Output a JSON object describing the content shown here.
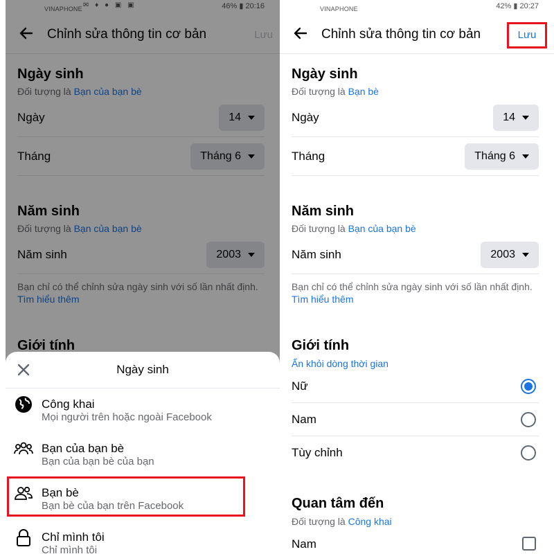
{
  "status": {
    "carrier": "VINAPHONE",
    "left_battery": "46%",
    "left_time": "20:16",
    "right_battery": "42%",
    "right_time": "20:27"
  },
  "header": {
    "title": "Chỉnh sửa thông tin cơ bản",
    "save_label": "Lưu"
  },
  "birthday": {
    "title": "Ngày sinh",
    "audience_prefix": "Đối tượng là",
    "audience_left": "Bạn của bạn bè",
    "audience_right": "Bạn bè",
    "day_label": "Ngày",
    "day_value": "14",
    "month_label": "Tháng",
    "month_value": "Tháng 6"
  },
  "birth_year": {
    "title": "Năm sinh",
    "audience_prefix": "Đối tượng là",
    "audience": "Bạn của bạn bè",
    "year_label": "Năm sinh",
    "year_value": "2003",
    "note": "Bạn chỉ có thể chỉnh sửa ngày sinh với số lần nhất định.",
    "learn_more": "Tìm hiểu thêm"
  },
  "gender": {
    "title": "Giới tính",
    "hide_link": "Ẩn khỏi dòng thời gian",
    "options": [
      {
        "label": "Nữ",
        "selected": true
      },
      {
        "label": "Nam",
        "selected": false
      },
      {
        "label": "Tùy chỉnh",
        "selected": false
      }
    ]
  },
  "interested_in": {
    "title": "Quan tâm đến",
    "audience_prefix": "Đối tượng là",
    "audience": "Công khai",
    "first_option": "Nam"
  },
  "sheet": {
    "title": "Ngày sinh",
    "options": [
      {
        "icon": "globe-icon",
        "title": "Công khai",
        "subtitle": "Mọi người trên hoặc ngoài Facebook"
      },
      {
        "icon": "friends-of-friends-icon",
        "title": "Bạn của bạn bè",
        "subtitle": "Bạn của bạn bè của bạn"
      },
      {
        "icon": "friends-icon",
        "title": "Bạn bè",
        "subtitle": "Bạn bè của bạn trên Facebook"
      },
      {
        "icon": "lock-icon",
        "title": "Chỉ mình tôi",
        "subtitle": "Chỉ mình tôi"
      }
    ]
  },
  "colors": {
    "accent": "#1b74e4",
    "highlight": "#e8131f",
    "pill": "#e4e6eb"
  }
}
